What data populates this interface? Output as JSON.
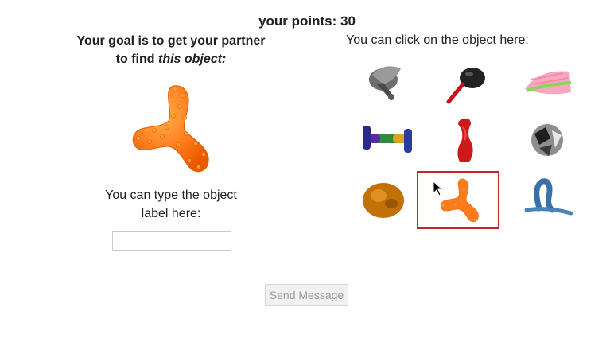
{
  "header": {
    "points_label": "your points:",
    "points_value": "30"
  },
  "left_panel": {
    "goal_line1": "Your goal is to get your partner",
    "goal_line2_prefix": "to find ",
    "goal_line2_emphasis": "this object:",
    "target_icon": "orange-spiky-tripod-object",
    "type_label_line1": "You can type the object",
    "type_label_line2": "label here:",
    "label_input": {
      "value": "",
      "placeholder": ""
    }
  },
  "right_panel": {
    "instruction": "You can click on the object here:",
    "objects": [
      {
        "icon": "gray-funnel-object",
        "selected": false
      },
      {
        "icon": "black-bulb-pump-object",
        "selected": false
      },
      {
        "icon": "pink-fan-object",
        "selected": false
      },
      {
        "icon": "rainbow-dumbbell-object",
        "selected": false
      },
      {
        "icon": "red-twisted-object",
        "selected": false
      },
      {
        "icon": "chrome-crumpled-object",
        "selected": false
      },
      {
        "icon": "amber-blob-object",
        "selected": false
      },
      {
        "icon": "orange-spiky-tripod-object",
        "selected": true
      },
      {
        "icon": "blue-loop-object",
        "selected": false
      }
    ]
  },
  "footer": {
    "send_label": "Send Message"
  },
  "colors": {
    "selection_border": "#c0272d",
    "target_orange": "#ff7a1a"
  }
}
